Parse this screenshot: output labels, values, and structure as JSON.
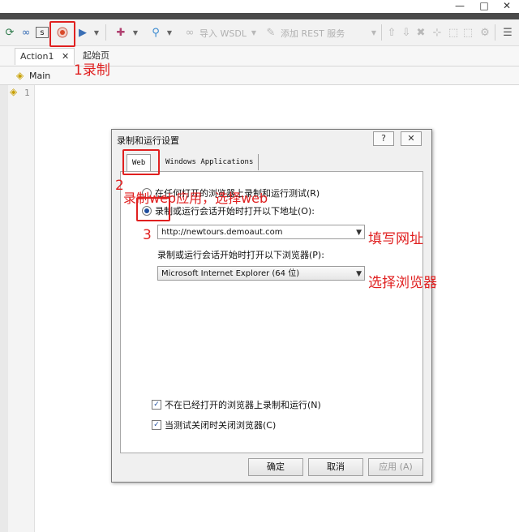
{
  "window": {
    "minimize": "—",
    "maximize": "□",
    "close": "✕"
  },
  "toolbar": {
    "import_wsdl": "导入 WSDL",
    "add_rest": "添加 REST 服务"
  },
  "tabs": [
    {
      "label": "Action1",
      "close": "✕"
    },
    {
      "label": "起始页"
    }
  ],
  "breadcrumb": {
    "label": "Main"
  },
  "editor": {
    "line_number": "1"
  },
  "annotations": {
    "step1": "1录制",
    "step2_num": "2",
    "step2_text": "录制web应用，选择web",
    "step3_num": "3",
    "fill_url": "填写网址",
    "choose_browser": "选择浏览器"
  },
  "dialog": {
    "title": "录制和运行设置",
    "help_button": "?",
    "close_button": "✕",
    "tabs": [
      "Web",
      "Windows Applications"
    ],
    "radio_any_browser": "在任何打开的浏览器上录制和运行测试(R)",
    "radio_open_url": "录制或运行会话开始时打开以下地址(O):",
    "url_value": "http://newtours.demoaut.com",
    "browser_label": "录制或运行会话开始时打开以下浏览器(P):",
    "browser_value": "Microsoft Internet Explorer (64 位)",
    "check_not_open": "不在已经打开的浏览器上录制和运行(N)",
    "check_close": "当测试关闭时关闭浏览器(C)",
    "btn_ok": "确定",
    "btn_cancel": "取消",
    "btn_apply": "应用 (A)"
  }
}
